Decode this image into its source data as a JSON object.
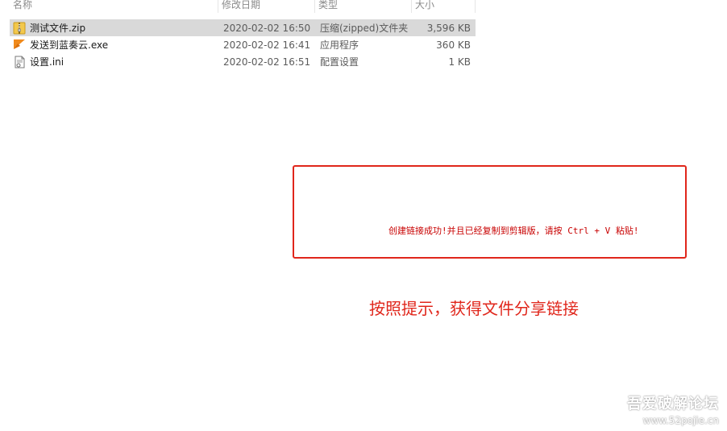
{
  "columns": {
    "name": "名称",
    "date": "修改日期",
    "type": "类型",
    "size": "大小"
  },
  "files": [
    {
      "name": "测试文件.zip",
      "date": "2020-02-02 16:50",
      "type": "压缩(zipped)文件夹",
      "size": "3,596 KB",
      "icon": "zip-folder-icon",
      "selected": true
    },
    {
      "name": "发送到蓝奏云.exe",
      "date": "2020-02-02 16:41",
      "type": "应用程序",
      "size": "360 KB",
      "icon": "application-icon",
      "selected": false
    },
    {
      "name": "设置.ini",
      "date": "2020-02-02 16:51",
      "type": "配置设置",
      "size": "1 KB",
      "icon": "ini-settings-icon",
      "selected": false
    }
  ],
  "message": {
    "text": "创建链接成功!并且已经复制到剪辑版，请按 Ctrl + V 粘贴!",
    "color": "#c80000",
    "border_color": "#e0261b"
  },
  "instruction": {
    "text": "按照提示，获得文件分享链接",
    "color": "#e0261b"
  },
  "watermark": {
    "logo": "吾爱破解论坛",
    "url": "www.52pojie.cn"
  },
  "colors": {
    "selected_row": "#d9d9d9",
    "header_text": "#8a8a8a"
  }
}
